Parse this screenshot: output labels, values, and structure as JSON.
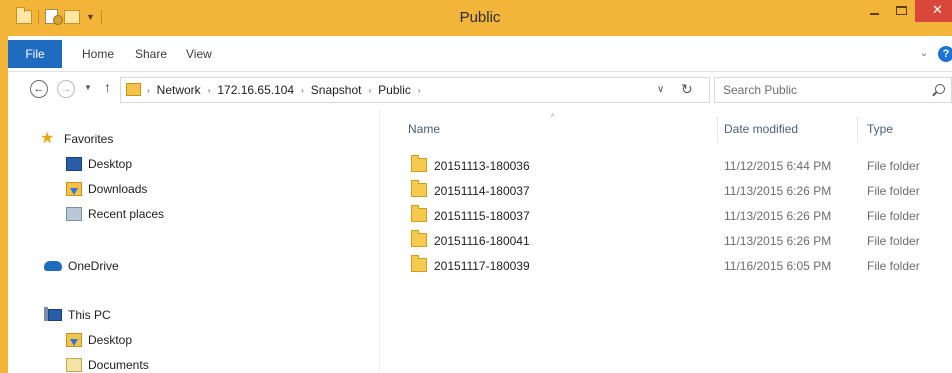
{
  "window": {
    "title": "Public"
  },
  "title_bar": {
    "close_glyph": "✕"
  },
  "ribbon": {
    "tabs": [
      "File",
      "Home",
      "Share",
      "View"
    ],
    "collapse_glyph": "⌄",
    "help_glyph": "?"
  },
  "nav": {
    "back_glyph": "←",
    "forward_glyph": "→",
    "recent_glyph": "▼",
    "up_glyph": "↑"
  },
  "address": {
    "separator": "›",
    "crumbs": [
      "Network",
      "172.16.65.104",
      "Snapshot",
      "Public"
    ],
    "dropdown_glyph": "∨",
    "refresh_glyph": "↻"
  },
  "search": {
    "placeholder": "Search Public",
    "value": ""
  },
  "navpane": {
    "favorites": {
      "label": "Favorites",
      "items": [
        "Desktop",
        "Downloads",
        "Recent places"
      ]
    },
    "onedrive": {
      "label": "OneDrive"
    },
    "thispc": {
      "label": "This PC",
      "items": [
        "Desktop",
        "Documents"
      ]
    }
  },
  "content": {
    "columns": {
      "name": "Name",
      "date_modified": "Date modified",
      "type": "Type"
    },
    "sort_glyph": "^",
    "rows": [
      {
        "name": "20151113-180036",
        "date_modified": "11/12/2015 6:44 PM",
        "type": "File folder"
      },
      {
        "name": "20151114-180037",
        "date_modified": "11/13/2015 6:26 PM",
        "type": "File folder"
      },
      {
        "name": "20151115-180037",
        "date_modified": "11/13/2015 6:26 PM",
        "type": "File folder"
      },
      {
        "name": "20151116-180041",
        "date_modified": "11/13/2015 6:26 PM",
        "type": "File folder"
      },
      {
        "name": "20151117-180039",
        "date_modified": "11/16/2015 6:05 PM",
        "type": "File folder"
      }
    ]
  },
  "colors": {
    "title_bar": "#f2b53a",
    "file_tab": "#1f6bc0",
    "close_button": "#d9463a",
    "column_header_text": "#4c607a"
  },
  "icons": {
    "quick_access": [
      "folder-icon",
      "properties-icon",
      "new-folder-icon",
      "customize-dropdown-icon"
    ],
    "nav": [
      "star-icon",
      "desktop-icon",
      "downloads-icon",
      "recent-places-icon",
      "onedrive-icon",
      "this-pc-icon",
      "documents-icon"
    ],
    "rows": "folder-icon"
  }
}
